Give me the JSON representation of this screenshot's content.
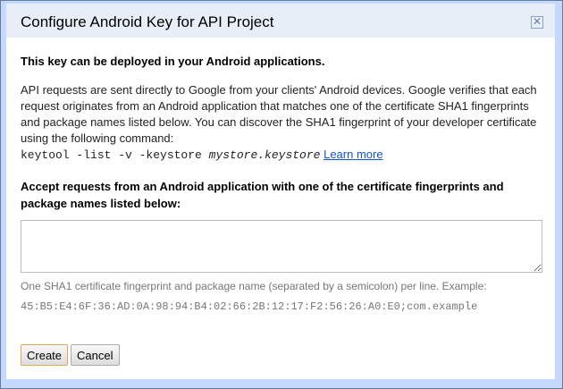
{
  "dialog": {
    "title": "Configure Android Key for API Project",
    "close_icon": "close-icon",
    "heading": "This key can be deployed in your Android applications.",
    "description": "API requests are sent directly to Google from your clients' Android devices. Google verifies that each request originates from an Android application that matches one of the certificate SHA1 fingerprints and package names listed below. You can discover the SHA1 fingerprint of your developer certificate using the following command:",
    "command_prefix": "keytool -list -v -keystore ",
    "command_italic": "mystore.keystore",
    "learn_more": "Learn more",
    "field_label": "Accept requests from an Android application with one of the certificate fingerprints and package names listed below:",
    "field_value": "",
    "hint": "One SHA1 certificate fingerprint and package name (separated by a semicolon) per line. Example:",
    "example": "45:B5:E4:6F:36:AD:0A:98:94:B4:02:66:2B:12:17:F2:56:26:A0:E0;com.example",
    "create": "Create",
    "cancel": "Cancel"
  }
}
